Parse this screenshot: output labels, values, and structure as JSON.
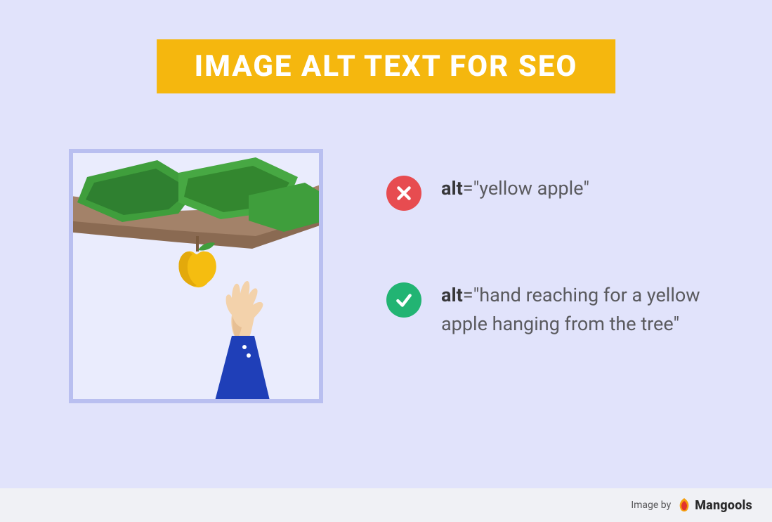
{
  "title": "IMAGE ALT TEXT FOR SEO",
  "examples": {
    "bad": {
      "attr": "alt",
      "value": "\"yellow apple\""
    },
    "good": {
      "attr": "alt",
      "value": "\"hand reaching for a yellow apple hanging from the tree\""
    }
  },
  "footer": {
    "credit_prefix": "Image by",
    "brand": "Mangools"
  },
  "colors": {
    "page_bg": "#e1e3fb",
    "banner_bg": "#f5b70e",
    "banner_text": "#ffffff",
    "frame_bg": "#eaecfd",
    "frame_border": "#b9bff0",
    "bad_badge": "#e74c50",
    "good_badge": "#22b473",
    "body_text": "#5a5a5e",
    "strong_text": "#373739",
    "footer_bg": "#f0f1f5"
  },
  "icons": {
    "bad": "cross-icon",
    "good": "check-icon",
    "brand_mark": "mangools-logo-icon"
  },
  "illustration": {
    "description": "A hand in a blue sleeve reaching up toward a yellow apple hanging from a leafy tree branch",
    "elements": [
      "tree-branch",
      "leaves",
      "yellow-apple",
      "reaching-hand",
      "blue-sleeve"
    ]
  }
}
